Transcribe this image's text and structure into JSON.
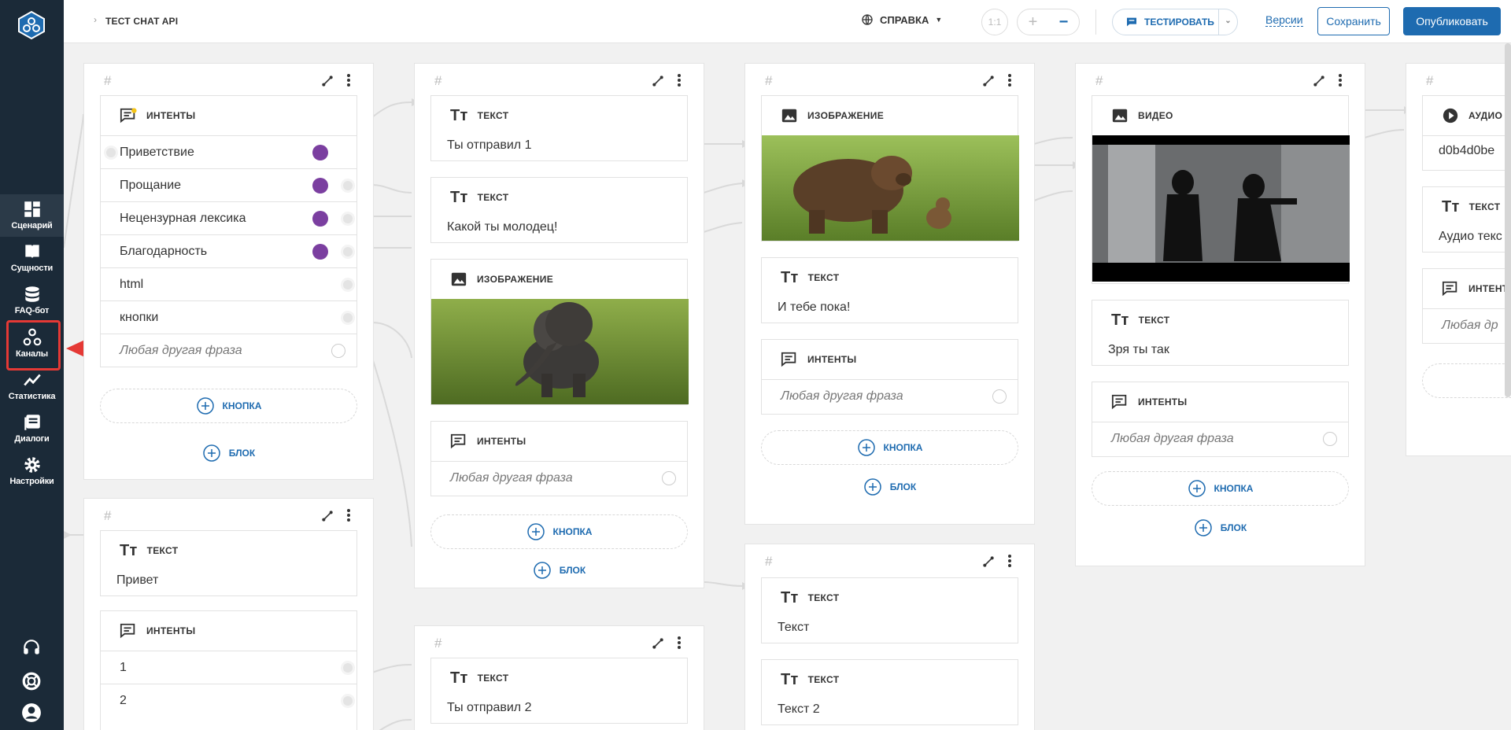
{
  "topbar": {
    "breadcrumb": "ТЕСТ CHAT API",
    "help_label": "СПРАВКА",
    "zoom_ratio": "1:1",
    "test_label": "ТЕСТИРОВАТЬ",
    "versions_label": "Версии",
    "save_label": "Сохранить",
    "publish_label": "Опубликовать"
  },
  "sidebar": {
    "items": [
      {
        "label": "Сценарий",
        "icon": "dashboard-icon"
      },
      {
        "label": "Сущности",
        "icon": "book-icon"
      },
      {
        "label": "FAQ-бот",
        "icon": "database-icon"
      },
      {
        "label": "Каналы",
        "icon": "channels-icon"
      },
      {
        "label": "Статистика",
        "icon": "chart-icon"
      },
      {
        "label": "Диалоги",
        "icon": "dialogs-icon"
      },
      {
        "label": "Настройки",
        "icon": "gear-icon"
      }
    ],
    "active": "Сценарий",
    "highlighted": "Каналы"
  },
  "columns": {
    "c1": {
      "intents_title": "ИНТЕНТЫ",
      "intents": [
        "Приветствие",
        "Прощание",
        "Нецензурная лексика",
        "Благодарность",
        "html",
        "кнопки"
      ],
      "other": "Любая другая фраза",
      "button_label": "КНОПКА",
      "block_label": "БЛОК"
    },
    "c1b": {
      "text_title": "ТЕКСТ",
      "text_value": "Привет",
      "intents_title": "ИНТЕНТЫ",
      "intents": [
        "1",
        "2"
      ]
    },
    "c2": {
      "text1_title": "ТЕКСТ",
      "text1_value": "Ты отправил 1",
      "text2_title": "ТЕКСТ",
      "text2_value": "Какой ты молодец!",
      "image_title": "ИЗОБРАЖЕНИЕ",
      "intents_title": "ИНТЕНТЫ",
      "other": "Любая другая фраза",
      "button_label": "КНОПКА",
      "block_label": "БЛОК"
    },
    "c2b": {
      "text_title": "ТЕКСТ",
      "text_value": "Ты отправил 2"
    },
    "c3": {
      "image_title": "ИЗОБРАЖЕНИЕ",
      "text_title": "ТЕКСТ",
      "text_value": "И тебе пока!",
      "intents_title": "ИНТЕНТЫ",
      "other": "Любая другая фраза",
      "button_label": "КНОПКА",
      "block_label": "БЛОК"
    },
    "c3b": {
      "text1_title": "ТЕКСТ",
      "text1_value": "Текст",
      "text2_title": "ТЕКСТ",
      "text2_value": "Текст 2"
    },
    "c4": {
      "video_title": "ВИДЕО",
      "text_title": "ТЕКСТ",
      "text_value": "Зря ты так",
      "intents_title": "ИНТЕНТЫ",
      "other": "Любая другая фраза",
      "button_label": "КНОПКА",
      "block_label": "БЛОК"
    },
    "c5": {
      "audio_title": "АУДИО",
      "audio_value": "d0b4d0be",
      "text_title": "ТЕКСТ",
      "text_value": "Аудио текс",
      "intents_title": "ИНТЕНТ",
      "other": "Любая др"
    }
  },
  "colors": {
    "sidebar_bg": "#1b2a38",
    "accent": "#1e6bb0",
    "annotation": "#e53935",
    "intent_badge": "#7b3fa0"
  }
}
